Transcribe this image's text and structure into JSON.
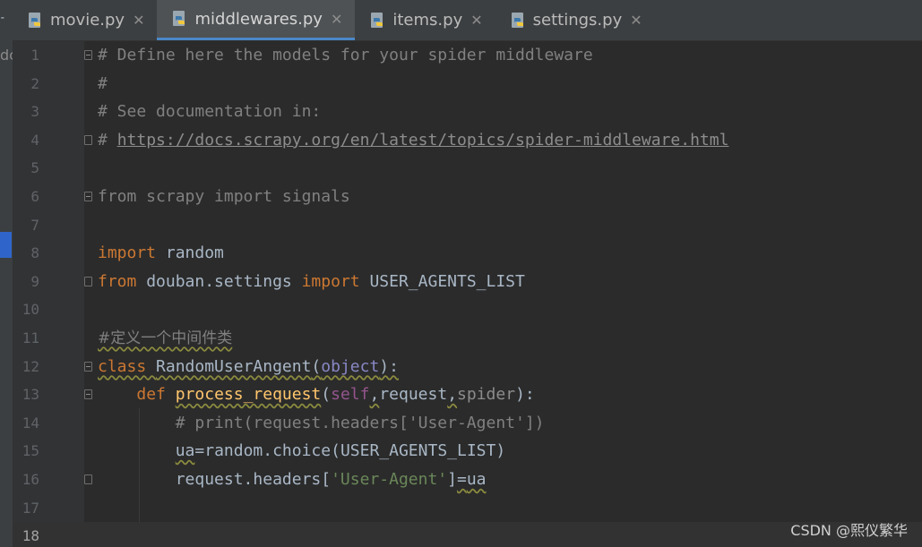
{
  "tabs": [
    {
      "label": "movie.py",
      "active": false
    },
    {
      "label": "middlewares.py",
      "active": true
    },
    {
      "label": "items.py",
      "active": false
    },
    {
      "label": "settings.py",
      "active": false
    }
  ],
  "icons": {
    "python_file": "python-file-icon",
    "close": "close-icon",
    "fold": "fold-marker-icon"
  },
  "sidebar": {
    "arrow": "⁃",
    "text": "dc"
  },
  "editor": {
    "line_numbers": [
      "1",
      "2",
      "3",
      "4",
      "5",
      "6",
      "7",
      "8",
      "9",
      "10",
      "11",
      "12",
      "13",
      "14",
      "15",
      "16",
      "17",
      "18"
    ],
    "current_line": 18,
    "lines": {
      "l1": "# Define here the models for your spider middleware",
      "l2": "#",
      "l3": "# See documentation in:",
      "l4_prefix": "# ",
      "l4_link": "https://docs.scrapy.org/en/latest/topics/spider-middleware.html",
      "l6": "from scrapy import signals",
      "l8_kw": "import",
      "l8_rest": " random",
      "l9_kw1": "from",
      "l9_mid": " douban.settings ",
      "l9_kw2": "import",
      "l9_rest": " USER_AGENTS_LIST",
      "l11": "#定义一个中间件类",
      "l12_kw": "class",
      "l12_name": "RandomUserAngent",
      "l12_open": "(",
      "l12_base": "object",
      "l12_close": "):",
      "l13_kw": "def",
      "l13_fn": "process_request",
      "l13_open": "(",
      "l13_self": "self",
      "l13_c1": ",",
      "l13_req": "request",
      "l13_c2": ",",
      "l13_spider": "spider",
      "l13_close": "):",
      "l14": "# print(request.headers['User-Agent'])",
      "l15_ua": "ua",
      "l15_rest": "=random.choice(USER_AGENTS_LIST)",
      "l16_pre": "request.headers[",
      "l16_str": "'User-Agent'",
      "l16_mid": "]",
      "l16_eq": "=",
      "l16_ua": "ua"
    }
  },
  "watermark": "CSDN @熙仪繁华"
}
